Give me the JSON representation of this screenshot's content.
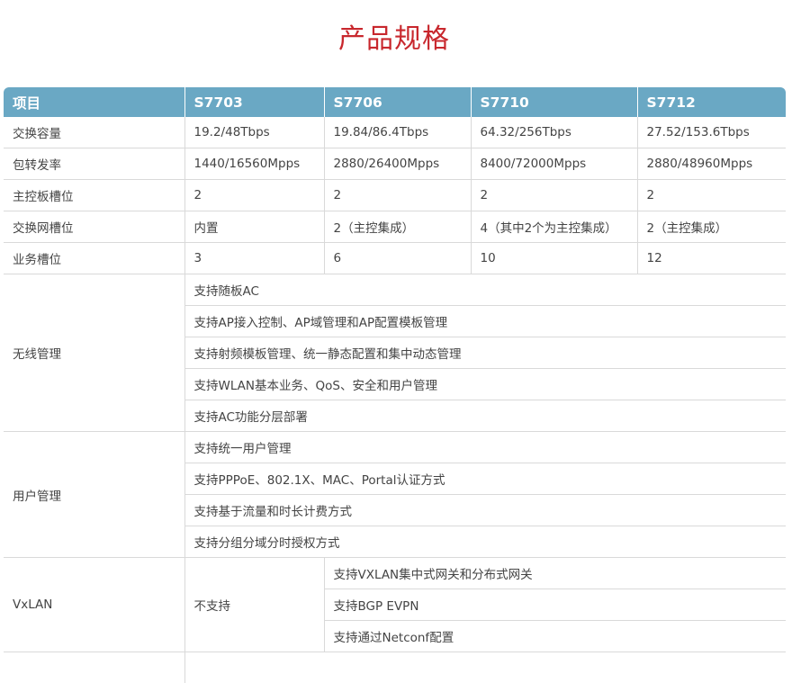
{
  "title": "产品规格",
  "header": [
    "项目",
    "S7703",
    "S7706",
    "S7710",
    "S7712"
  ],
  "basic_rows": [
    {
      "label": "交换容量",
      "values": [
        "19.2/48Tbps",
        "19.84/86.4Tbps",
        "64.32/256Tbps",
        "27.52/153.6Tbps"
      ]
    },
    {
      "label": "包转发率",
      "values": [
        "1440/16560Mpps",
        "2880/26400Mpps",
        "8400/72000Mpps",
        "2880/48960Mpps"
      ]
    },
    {
      "label": "主控板槽位",
      "values": [
        "2",
        "2",
        "2",
        "2"
      ]
    },
    {
      "label": "交换网槽位",
      "values": [
        "内置",
        "2（主控集成）",
        "4（其中2个为主控集成）",
        "2（主控集成）"
      ]
    },
    {
      "label": "业务槽位",
      "values": [
        "3",
        "6",
        "10",
        "12"
      ]
    }
  ],
  "wireless": {
    "label": "无线管理",
    "items": [
      "支持随板AC",
      "支持AP接入控制、AP域管理和AP配置模板管理",
      "支持射频模板管理、统一静态配置和集中动态管理",
      "支持WLAN基本业务、QoS、安全和用户管理",
      "支持AC功能分层部署"
    ]
  },
  "user_mgmt": {
    "label": "用户管理",
    "items": [
      "支持统一用户管理",
      "支持PPPoE、802.1X、MAC、Portal认证方式",
      "支持基于流量和时长计费方式",
      "支持分组分域分时授权方式"
    ]
  },
  "vxlan": {
    "label": "VxLAN",
    "s7703": "不支持",
    "items": [
      "支持VXLAN集中式网关和分布式网关",
      "支持BGP EVPN",
      "支持通过Netconf配置"
    ]
  }
}
